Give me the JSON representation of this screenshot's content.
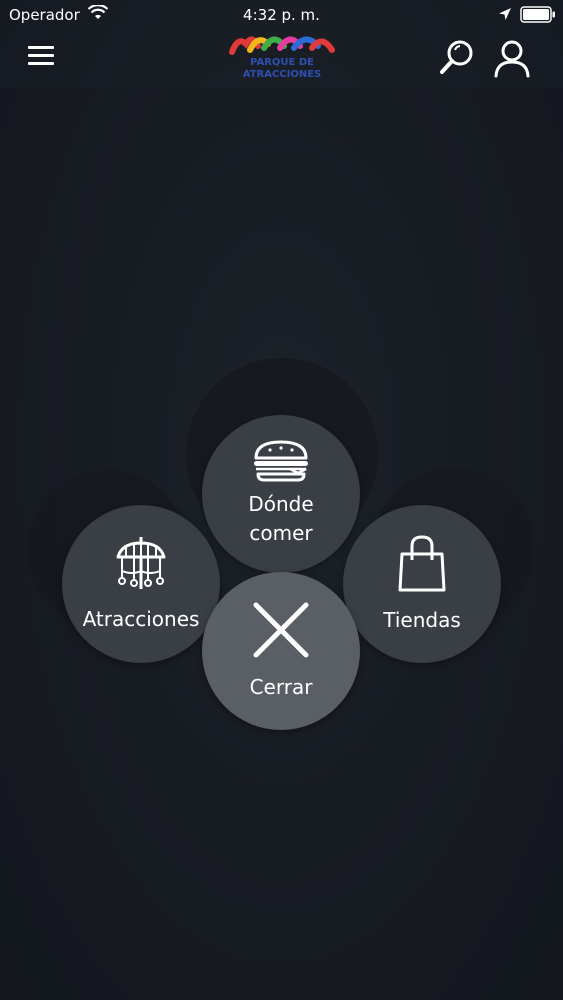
{
  "status_bar": {
    "carrier": "Operador",
    "time": "4:32 p. m."
  },
  "header": {
    "logo_line1": "PARQUE DE",
    "logo_line2": "ATRACCIONES"
  },
  "fab_menu": {
    "food_label_line1": "Dónde",
    "food_label_line2": "comer",
    "attractions_label": "Atracciones",
    "shops_label": "Tiendas",
    "close_label": "Cerrar"
  },
  "colors": {
    "background": "#1a1f26",
    "bubble": "#3a3f45",
    "bubble_close": "#5a5f65",
    "text": "#ffffff"
  }
}
